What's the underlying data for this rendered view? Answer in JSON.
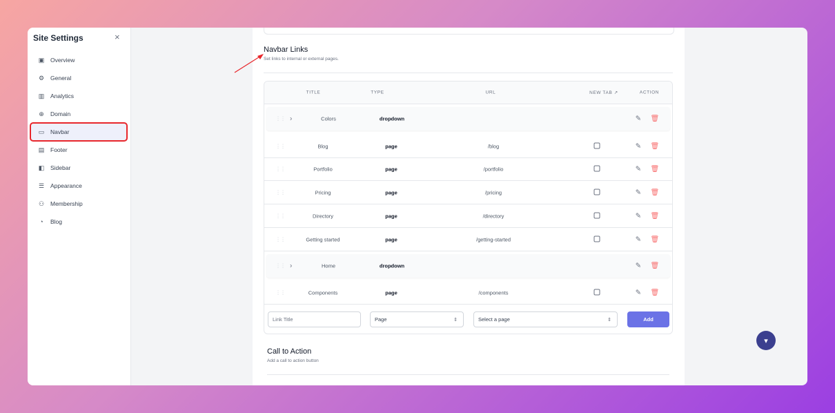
{
  "sidebar": {
    "title": "Site Settings",
    "close_icon": "×",
    "items": [
      {
        "label": "Overview",
        "icon": "presentation-icon",
        "glyph": "▣"
      },
      {
        "label": "General",
        "icon": "gear-icon",
        "glyph": "⚙"
      },
      {
        "label": "Analytics",
        "icon": "bar-chart-icon",
        "glyph": "▥"
      },
      {
        "label": "Domain",
        "icon": "globe-icon",
        "glyph": "⊕"
      },
      {
        "label": "Navbar",
        "icon": "monitor-icon",
        "glyph": "▭",
        "active": true
      },
      {
        "label": "Footer",
        "icon": "footer-icon",
        "glyph": "▤"
      },
      {
        "label": "Sidebar",
        "icon": "sidebar-icon",
        "glyph": "◧"
      },
      {
        "label": "Appearance",
        "icon": "sliders-icon",
        "glyph": "☰"
      },
      {
        "label": "Membership",
        "icon": "users-icon",
        "glyph": "⚇"
      },
      {
        "label": "Blog",
        "icon": "blog-icon",
        "glyph": "◔"
      }
    ]
  },
  "section": {
    "title": "Navbar Links",
    "subtitle": "Set links to internal or external pages."
  },
  "table": {
    "headers": {
      "title": "TITLE",
      "type": "TYPE",
      "url": "URL",
      "new_tab": "NEW TAB",
      "action": "ACTION"
    },
    "rows": [
      {
        "title": "Colors",
        "type": "dropdown",
        "url": "",
        "expandable": true
      },
      {
        "title": "Blog",
        "type": "page",
        "url": "/blog",
        "new_tab": false
      },
      {
        "title": "Portfolio",
        "type": "page",
        "url": "/portfolio",
        "new_tab": false
      },
      {
        "title": "Pricing",
        "type": "page",
        "url": "/pricing",
        "new_tab": false
      },
      {
        "title": "Directory",
        "type": "page",
        "url": "/directory",
        "new_tab": false
      },
      {
        "title": "Getting started",
        "type": "page",
        "url": "/getting-started",
        "new_tab": false
      },
      {
        "title": "Home",
        "type": "dropdown",
        "url": "",
        "expandable": true
      },
      {
        "title": "Components",
        "type": "page",
        "url": "/components",
        "new_tab": false
      }
    ]
  },
  "add_form": {
    "title_placeholder": "Link Title",
    "type_value": "Page",
    "page_placeholder": "Select a page",
    "add_label": "Add"
  },
  "cta": {
    "title": "Call to Action",
    "subtitle": "Add a call to action button"
  },
  "colors": {
    "accent": "#6b72e6",
    "delete": "#f87171",
    "highlight": "#e8262b"
  }
}
